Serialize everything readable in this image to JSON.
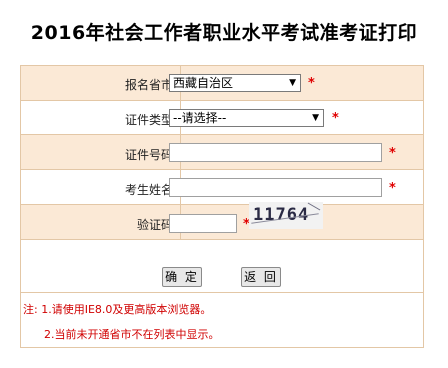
{
  "page": {
    "title": "2016年社会工作者职业水平考试准考证打印"
  },
  "form": {
    "province": {
      "label": "报名省市:",
      "selected": "西藏自治区",
      "required_mark": "*"
    },
    "id_type": {
      "label": "证件类型:",
      "selected": "--请选择--",
      "required_mark": "*"
    },
    "id_number": {
      "label": "证件号码:",
      "value": "",
      "required_mark": "*"
    },
    "name": {
      "label": "考生姓名:",
      "value": "",
      "required_mark": "*"
    },
    "captcha": {
      "label": "验证码:",
      "value": "",
      "required_mark": "*",
      "image_text": "11764"
    }
  },
  "buttons": {
    "confirm": "确 定",
    "back": "返 回"
  },
  "notes": {
    "line1": "注: 1.请使用IE8.0及更高版本浏览器。",
    "line2": "2.当前未开通省市不在列表中显示。"
  },
  "colors": {
    "row_shade": "#fbe9d6",
    "border": "#e3c7a6",
    "required": "#e00000"
  }
}
